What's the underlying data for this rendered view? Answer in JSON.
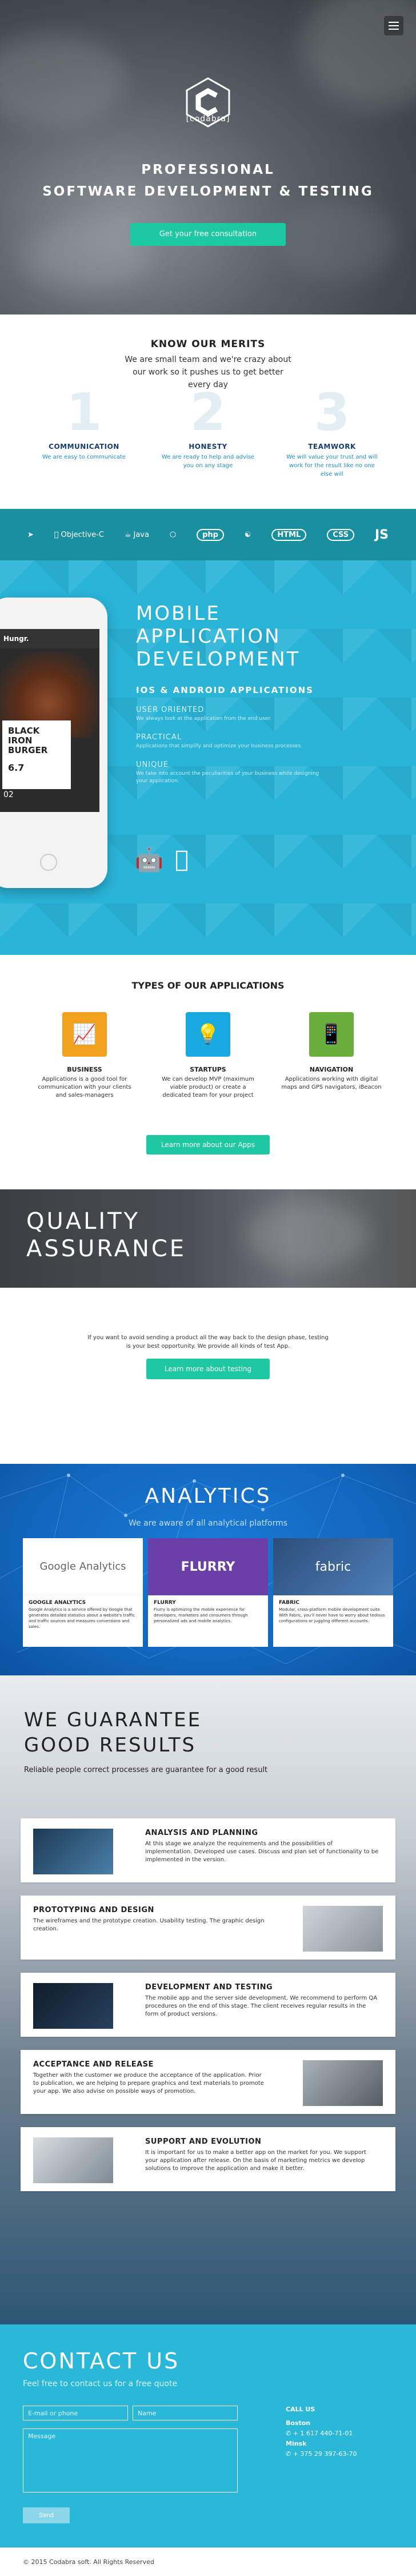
{
  "hero": {
    "logo_text": "[codabra]",
    "title_line1": "PROFESSIONAL",
    "title_line2": "SOFTWARE DEVELOPMENT & TESTING",
    "cta": "Get your free consultation"
  },
  "merits": {
    "title": "KNOW OUR MERITS",
    "subtitle": "We are small team and we're crazy about our work so it pushes us to get better every day",
    "items": [
      {
        "num": "1",
        "title": "COMMUNICATION",
        "text": "We are easy to communicate"
      },
      {
        "num": "2",
        "title": "HONESTY",
        "text": "We are ready to help and advise you on any stage"
      },
      {
        "num": "3",
        "title": "TEAMWORK",
        "text": "We will value your trust and will work for the result like no one else will"
      }
    ]
  },
  "tech": [
    "Objective-C",
    "Java",
    "php",
    "HTML",
    "CSS",
    "JS"
  ],
  "mobile": {
    "title": "MOBILE APPLICATION DEVELOPMENT",
    "subtitle": "IOS & ANDROID APPLICATIONS",
    "features": [
      {
        "title": "USER ORIENTED",
        "text": "We always look at the application from the end user."
      },
      {
        "title": "PRACTICAL",
        "text": "Applications that simplify and optimize your business processes."
      },
      {
        "title": "UNIQUE",
        "text": "We take into account the peculiarities of your business while designing your application."
      }
    ],
    "phone": {
      "app": "Hungr.",
      "dish_line1": "BLACK IRON",
      "dish_line2": "BURGER",
      "score": "6.7",
      "num": "02"
    }
  },
  "types": {
    "title": "TYPES OF OUR APPLICATIONS",
    "items": [
      {
        "title": "BUSINESS",
        "text": "Applications is a good tool for communication with your clients and sales-managers",
        "color": "#f2a11f"
      },
      {
        "title": "STARTUPS",
        "text": "We can develop MVP (maximum viable product) or create a dedicated team for your project",
        "color": "#18a9e0"
      },
      {
        "title": "NAVIGATION",
        "text": "Applications working with digital maps and GPS navigators, iBeacon",
        "color": "#6aaf3d"
      }
    ],
    "cta": "Learn more about our Apps"
  },
  "qa": {
    "title_line1": "QUALITY",
    "title_line2": "ASSURANCE",
    "text": "If you want to avoid sending a product all the way back to the design phase, testing is your best opportunity. We provide all kinds of test App.",
    "cta": "Learn more about testing"
  },
  "analytics": {
    "title": "ANALYTICS",
    "subtitle": "We are aware of all analytical platforms",
    "cards": [
      {
        "logo": "Google Analytics",
        "title": "GOOGLE ANALYTICS",
        "text": "Google Analytics is a service offered by Google that generates detailed statistics about a website's traffic and traffic sources and measures conversions and sales.",
        "color": "#d9473b"
      },
      {
        "logo": "FLURRY",
        "title": "FLURRY",
        "text": "Flurry is optimizing the mobile experience for developers, marketers and consumers through personalized ads and mobile analytics.",
        "color": "#6a3fa8"
      },
      {
        "logo": "fabric",
        "title": "FABRIC",
        "text": "Modular, cross-platform mobile development suite. With Fabric, you'll never have to worry about tedious configurations or juggling different accounts.",
        "color": "#2c4d7a"
      }
    ]
  },
  "guarantee": {
    "title_line1": "WE GUARANTEE",
    "title_line2": "GOOD RESULTS",
    "subtitle": "Reliable people correct processes are guarantee for a good result",
    "steps": [
      {
        "title": "ANALYSIS AND PLANNING",
        "text": "At this stage we analyze the requirements and the possibilities of implementation. Developed use cases. Discuss and plan set of functionality to be implemented in the version."
      },
      {
        "title": "PROTOTYPING AND DESIGN",
        "text": "The wireframes and the prototype creation. Usability testing. The graphic design creation."
      },
      {
        "title": "DEVELOPMENT AND TESTING",
        "text": "The mobile app and the server side development. We recommend to perform QA procedures on the end of this stage. The client receives regular results in the form of product versions."
      },
      {
        "title": "ACCEPTANCE AND RELEASE",
        "text": "Together with the customer we produce the acceptance of the application. Prior to publication, we are helping to prepare graphics and text materials to promote your app. We also advise on possible ways of promotion."
      },
      {
        "title": "SUPPORT AND EVOLUTION",
        "text": "It is important for us to make a better app on the market for you. We support your application after release. On the basis of marketing metrics we develop solutions to improve the application and make it better."
      }
    ]
  },
  "contact": {
    "title": "CONTACT US",
    "subtitle": "Feel free to contact us for a free quote",
    "email_placeholder": "E-mail or phone",
    "name_placeholder": "Name",
    "message_placeholder": "Message",
    "send": "Send",
    "call_title": "CALL US",
    "offices": [
      {
        "city": "Boston",
        "phone": "+ 1 617 440-71-01"
      },
      {
        "city": "Minsk",
        "phone": "+ 375 29 397-63-70"
      }
    ]
  },
  "footer": {
    "copyright": "© 2015 Codabra soft. All Rights Reserved"
  }
}
